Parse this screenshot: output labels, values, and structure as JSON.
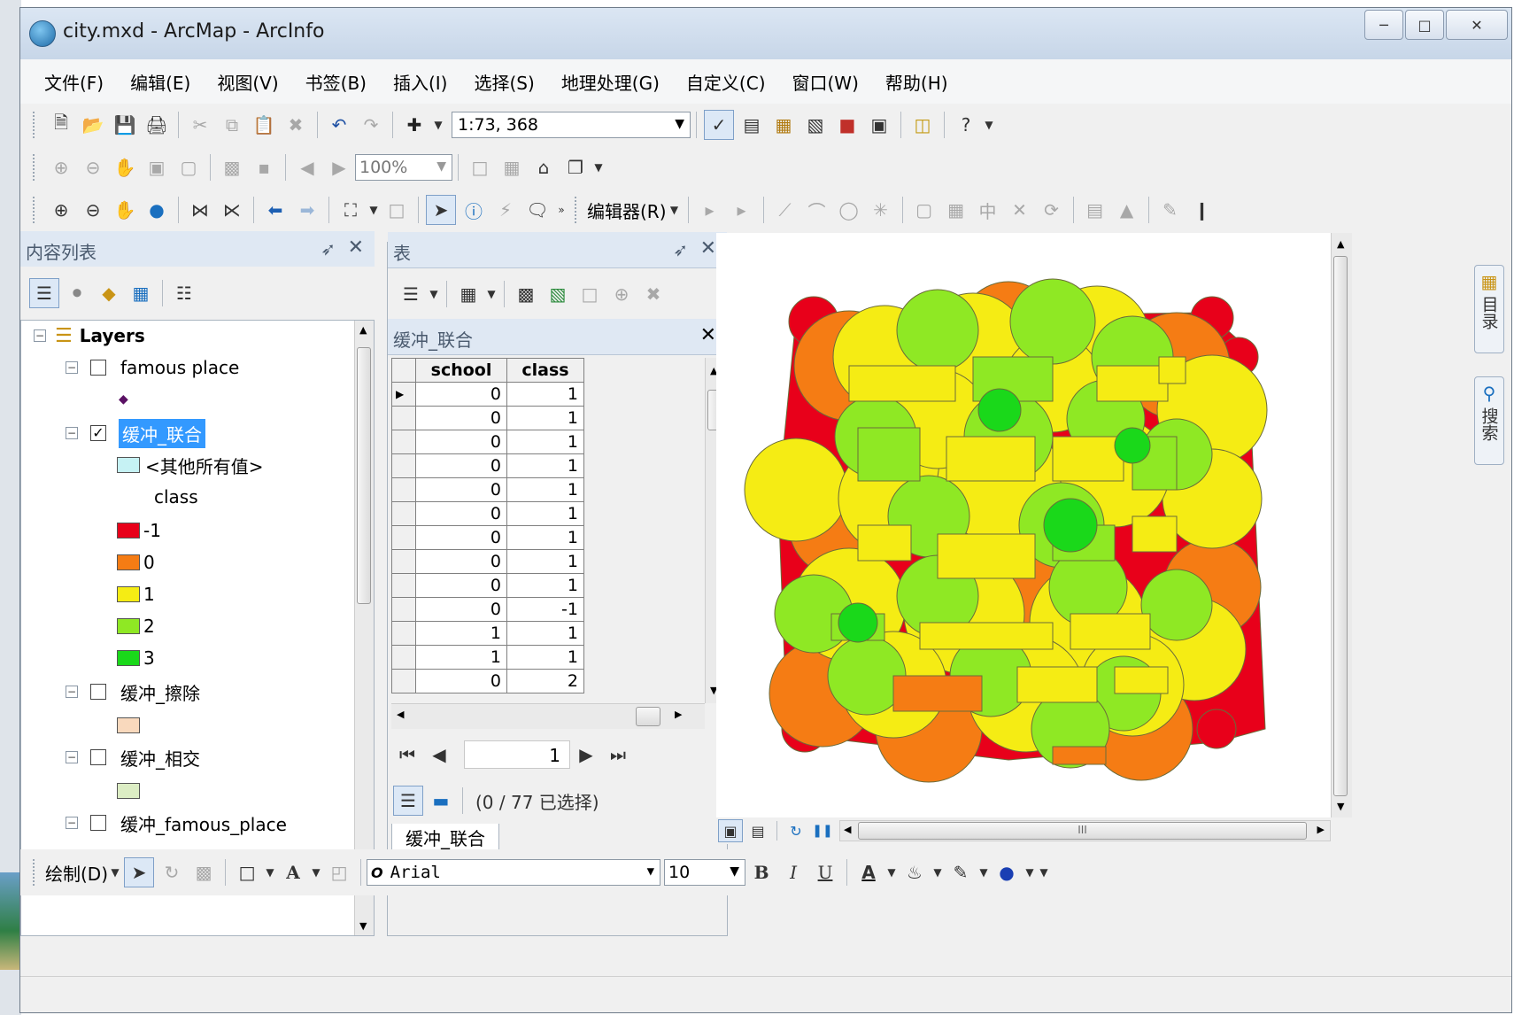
{
  "window": {
    "title": "city.mxd - ArcMap - ArcInfo",
    "controls": [
      "minimize-icon",
      "maximize-icon",
      "close-icon"
    ]
  },
  "menu": [
    "文件(F)",
    "编辑(E)",
    "视图(V)",
    "书签(B)",
    "插入(I)",
    "选择(S)",
    "地理处理(G)",
    "自定义(C)",
    "窗口(W)",
    "帮助(H)"
  ],
  "toolbar_standard": {
    "scale": "1:73, 368",
    "help_label": "?"
  },
  "toolbar_layout": {
    "zoom": "100%"
  },
  "toolbar_tools": {
    "editor_label": "编辑器(R)"
  },
  "toc": {
    "title": "内容列表",
    "layers_label": "Layers",
    "famous_place": "famous place",
    "union_layer": "缓冲_联合",
    "other_values": "<其他所有值>",
    "class_field": "class",
    "classes": [
      {
        "label": "-1",
        "color": "#e8001a"
      },
      {
        "label": "0",
        "color": "#f57c14"
      },
      {
        "label": "1",
        "color": "#f5ec14"
      },
      {
        "label": "2",
        "color": "#8fe824"
      },
      {
        "label": "3",
        "color": "#1ad81a"
      }
    ],
    "erase_layer": "缓冲_擦除",
    "erase_color": "#f9d9bd",
    "intersect_layer": "缓冲_相交",
    "intersect_color": "#dcedc4",
    "famous_buffer_layer": "缓冲_famous_place",
    "union_swatch_color": "#c6f2f4"
  },
  "table_panel": {
    "title": "表",
    "table_name": "缓冲_联合",
    "columns": [
      "school",
      "class"
    ],
    "rows": [
      [
        "0",
        "1"
      ],
      [
        "0",
        "1"
      ],
      [
        "0",
        "1"
      ],
      [
        "0",
        "1"
      ],
      [
        "0",
        "1"
      ],
      [
        "0",
        "1"
      ],
      [
        "0",
        "1"
      ],
      [
        "0",
        "1"
      ],
      [
        "0",
        "1"
      ],
      [
        "0",
        "-1"
      ],
      [
        "1",
        "1"
      ],
      [
        "1",
        "1"
      ],
      [
        "0",
        "2"
      ]
    ],
    "current_record": "1",
    "selection_text": "(0 / 77 已选择)",
    "tab_label": "缓冲_联合"
  },
  "right_tabs": {
    "catalog": "目录",
    "search": "搜索"
  },
  "map_bottom": {
    "scroll_marker": "III"
  },
  "draw_toolbar": {
    "draw_label": "绘制(D)",
    "font_name": "Arial",
    "font_size": "10",
    "bold": "B",
    "italic": "I",
    "underline": "U",
    "font_color_letter": "A"
  }
}
